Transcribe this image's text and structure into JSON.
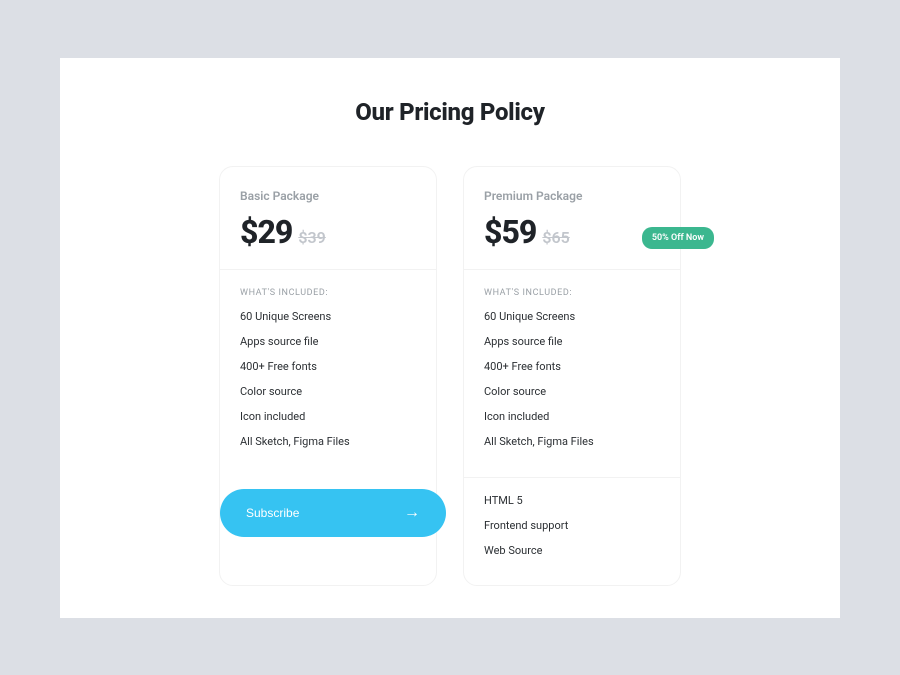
{
  "title": "Our Pricing Policy",
  "includedLabel": "WHAT'S INCLUDED:",
  "badge": "50% Off Now",
  "plans": {
    "basic": {
      "name": "Basic Package",
      "price": "$29",
      "original": "$39",
      "features": [
        "60 Unique Screens",
        "Apps source file",
        "400+ Free fonts",
        "Color source",
        "Icon included",
        "All Sketch, Figma Files"
      ],
      "cta": "Subscribe"
    },
    "premium": {
      "name": "Premium Package",
      "price": "$59",
      "original": "$65",
      "features": [
        "60 Unique Screens",
        "Apps source file",
        "400+ Free fonts",
        "Color source",
        "Icon included",
        "All Sketch, Figma Files"
      ],
      "extras": [
        "HTML 5",
        "Frontend support",
        "Web Source"
      ]
    }
  }
}
